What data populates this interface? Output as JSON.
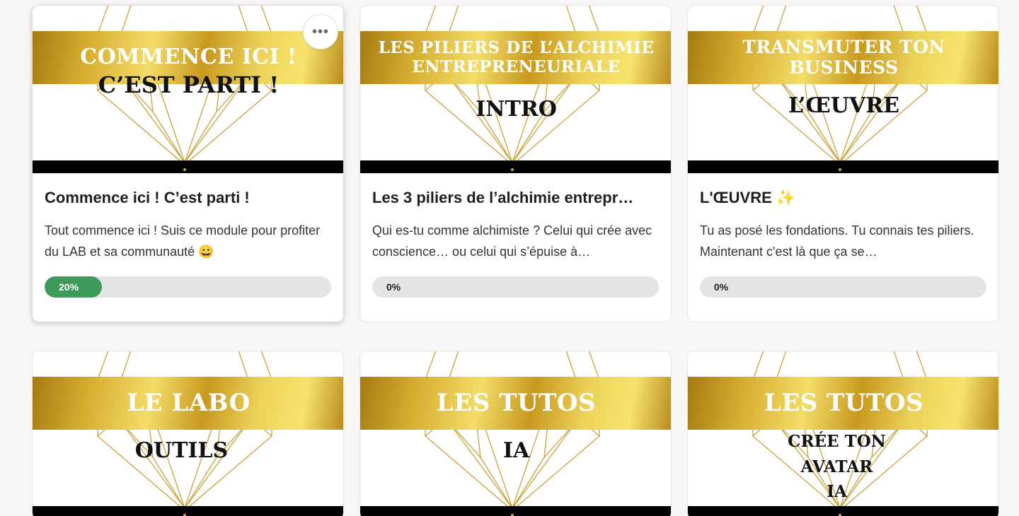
{
  "courses": [
    {
      "banner_lines": [
        "COMMENCE ICI !"
      ],
      "subtitle_lines": [
        "C’EST PARTI !"
      ],
      "title": "Commence ici ! C’est parti !",
      "description": "Tout commence ici ! Suis ce module pour profiter du LAB et sa communauté 😀",
      "progress_label": "20%",
      "progress_fraction": 0.2
    },
    {
      "banner_lines": [
        "LES PILIERS DE L’ALCHIMIE",
        "ENTREPRENEURIALE"
      ],
      "subtitle_lines": [
        "INTRO"
      ],
      "title": "Les 3 piliers de l’alchimie entrepr…",
      "description": "Qui es-tu comme alchimiste ? Celui qui crée avec conscience… ou celui qui s’épuise à…",
      "progress_label": "0%",
      "progress_fraction": 0
    },
    {
      "banner_lines": [
        "TRANSMUTER TON BUSINESS"
      ],
      "subtitle_lines": [
        "L’ŒUVRE"
      ],
      "title": "L'ŒUVRE ✨",
      "description": "Tu as posé les fondations. Tu connais tes piliers. Maintenant c'est là que ça se…",
      "progress_label": "0%",
      "progress_fraction": 0
    },
    {
      "banner_lines": [
        "LE LABO"
      ],
      "subtitle_lines": [
        "OUTILS"
      ]
    },
    {
      "banner_lines": [
        "LES TUTOS"
      ],
      "subtitle_lines": [
        "IA"
      ]
    },
    {
      "banner_lines": [
        "LES TUTOS"
      ],
      "subtitle_lines": [
        "CRÉE TON",
        "AVATAR",
        "IA"
      ]
    }
  ],
  "card_menu_icon": "ellipsis-icon",
  "colors": {
    "progress_fill": "#3d9a5b",
    "progress_track": "#e4e4e4",
    "gold": "#e2c04a"
  }
}
